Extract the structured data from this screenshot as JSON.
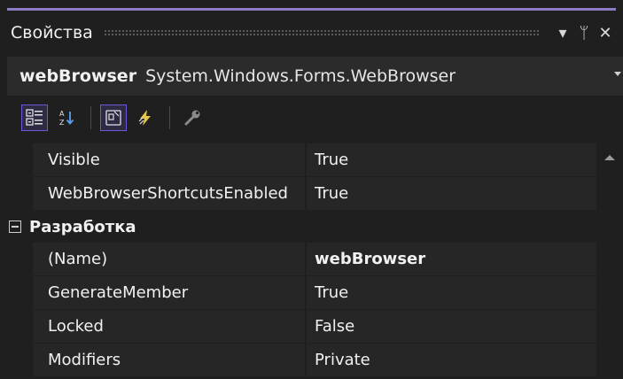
{
  "window": {
    "title": "Свойства",
    "controls": [
      "▾",
      "ᛘ",
      "✕"
    ]
  },
  "selector": {
    "object_name": "webBrowser",
    "object_type": "System.Windows.Forms.WebBrowser"
  },
  "toolbar": {
    "tools": [
      {
        "icon": "categorized-icon",
        "active": true
      },
      {
        "icon": "alphabetical-icon",
        "active": false
      },
      {
        "icon": "properties-icon",
        "active": true
      },
      {
        "icon": "events-icon",
        "active": false
      },
      {
        "icon": "property-pages-icon",
        "active": false
      }
    ]
  },
  "grid": {
    "rows_top": [
      {
        "name": "Visible",
        "value": "True"
      },
      {
        "name": "WebBrowserShortcutsEnabled",
        "value": "True"
      }
    ],
    "category": {
      "label": "Разработка",
      "expanded": true
    },
    "rows_design": [
      {
        "name": "(Name)",
        "value": "webBrowser",
        "bold": true
      },
      {
        "name": "GenerateMember",
        "value": "True"
      },
      {
        "name": "Locked",
        "value": "False"
      },
      {
        "name": "Modifiers",
        "value": "Private"
      }
    ]
  },
  "colors": {
    "accent": "#8e7cc3",
    "background": "#1f1f1f",
    "row_bg": "#262626",
    "active_tool_border": "#6e57d6"
  }
}
